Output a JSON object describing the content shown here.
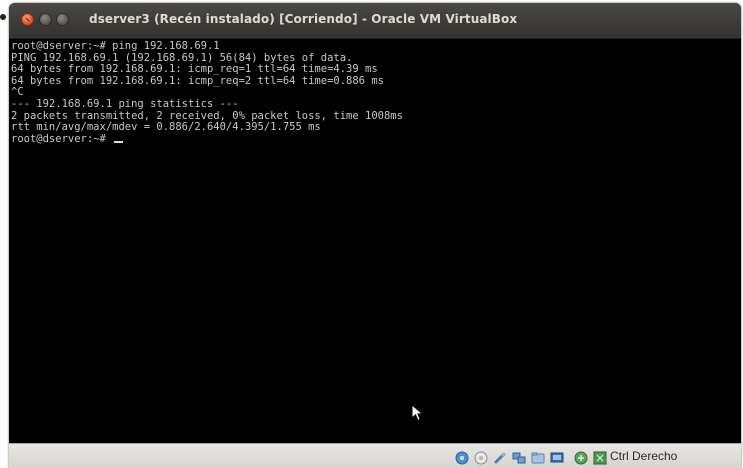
{
  "window": {
    "title": "dserver3 (Recén instalado) [Corriendo] - Oracle VM VirtualBox"
  },
  "terminal": {
    "lines": [
      "root@dserver:~# ping 192.168.69.1",
      "PING 192.168.69.1 (192.168.69.1) 56(84) bytes of data.",
      "64 bytes from 192.168.69.1: icmp_req=1 ttl=64 time=4.39 ms",
      "64 bytes from 192.168.69.1: icmp_req=2 ttl=64 time=0.886 ms",
      "^C",
      "--- 192.168.69.1 ping statistics ---",
      "2 packets transmitted, 2 received, 0% packet loss, time 1008ms",
      "rtt min/avg/max/mdev = 0.886/2.640/4.395/1.755 ms",
      "root@dserver:~# "
    ]
  },
  "statusbar": {
    "icons": [
      "hard-disk-icon",
      "optical-drive-icon",
      "usb-icon",
      "network-icon",
      "shared-folders-icon",
      "display-icon",
      "mouse-integration-icon",
      "host-key-indicator-icon"
    ],
    "host_key_label": "Ctrl Derecho"
  },
  "colors": {
    "titlebar": "#3c3b37",
    "title_text": "#dfdbd2",
    "close_button": "#e2522b",
    "terminal_bg": "#000000",
    "terminal_text": "#c9c9c9",
    "statusbar_bg": "#dedbd5"
  }
}
